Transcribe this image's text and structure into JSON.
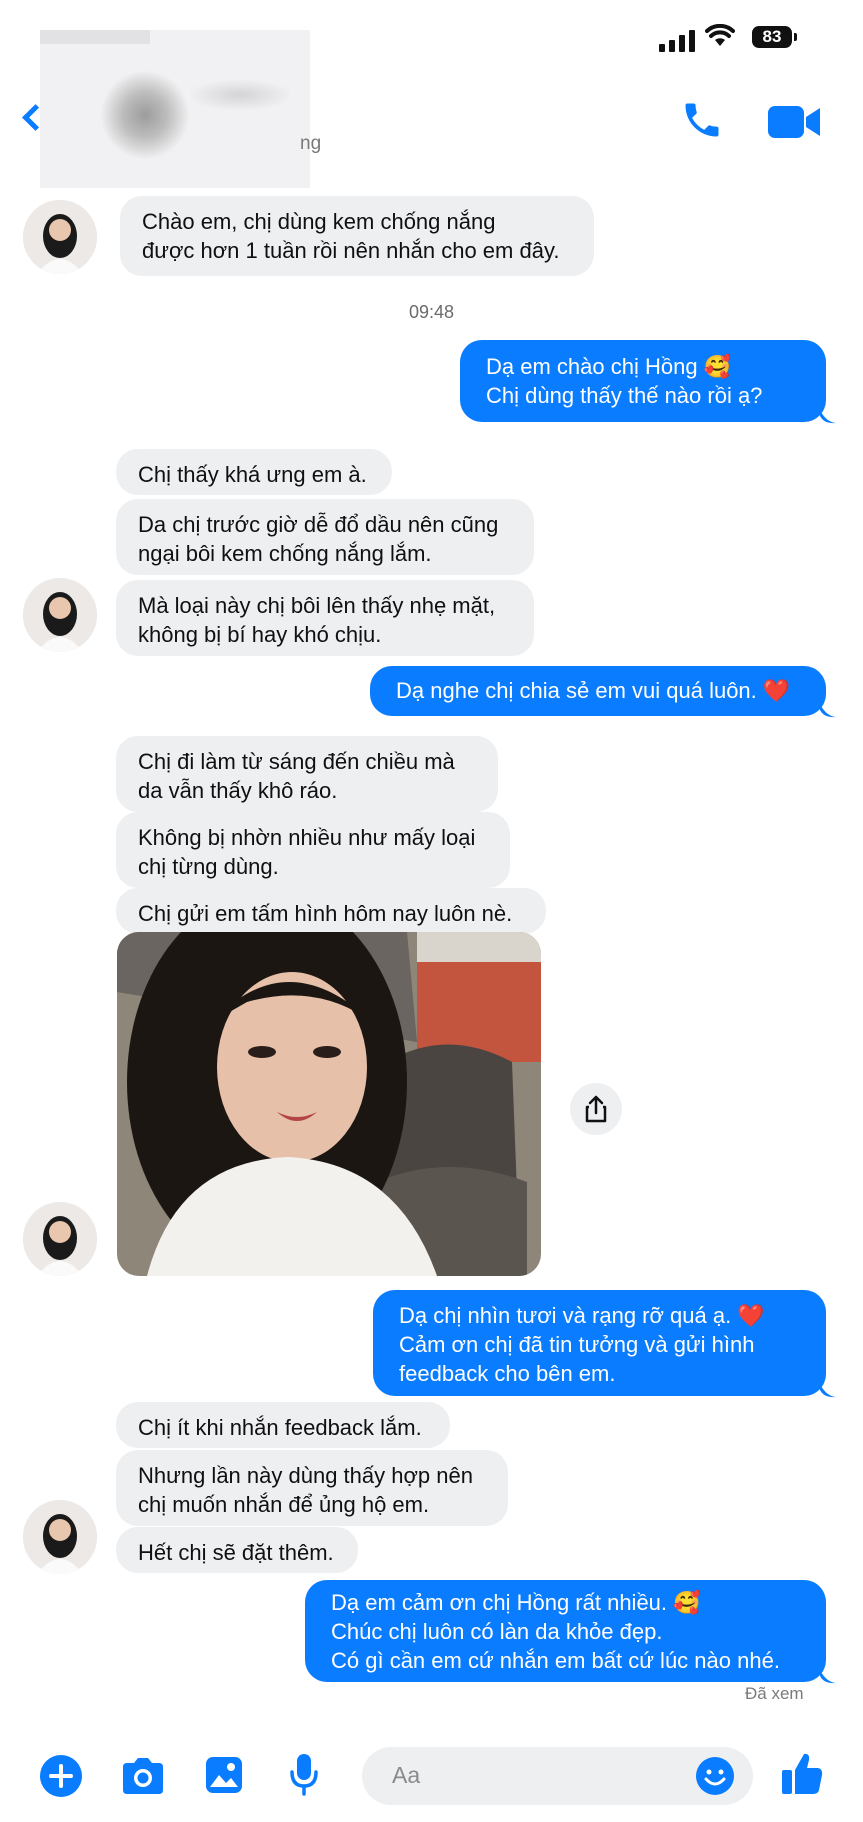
{
  "status_bar": {
    "battery": "83"
  },
  "header": {
    "contact_sub": "ng"
  },
  "messages": {
    "m1": "Chào em, chị dùng kem chống nắng\nđược hơn 1 tuần rồi nên nhắn cho em đây.",
    "time1": "09:48",
    "m2": "Dạ em chào chị Hồng 🥰\nChị dùng thấy thế nào rồi ạ?",
    "m3": "Chị thấy khá ưng em à.",
    "m4": "Da chị trước giờ dễ đổ dầu nên cũng\nngại bôi kem chống nắng lắm.",
    "m5": "Mà loại này chị bôi lên thấy nhẹ mặt,\nkhông bị bí hay khó chịu.",
    "m6": "Dạ nghe chị chia sẻ em vui quá luôn. ❤️",
    "m7": "Chị đi làm từ sáng đến chiều mà\nda vẫn thấy khô ráo.",
    "m8": "Không bị nhờn nhiều như mấy loại\nchị từng dùng.",
    "m9": "Chị gửi em tấm hình hôm nay luôn nè.",
    "m10": "Dạ chị nhìn tươi và rạng rỡ quá ạ. ❤️\nCảm ơn chị đã tin tưởng và gửi hình\nfeedback cho bên em.",
    "m11": "Chị ít khi nhắn feedback lắm.",
    "m12": "Nhưng lần này dùng thấy hợp nên\nchị muốn nhắn để ủng hộ em.",
    "m13": "Hết chị sẽ đặt thêm.",
    "m14": "Dạ em cảm ơn chị Hồng rất nhiều. 🥰\nChúc chị luôn có làn da khỏe đẹp.\nCó gì cần em cứ nhắn em bất cứ lúc nào nhé.",
    "seen": "Đã xem"
  },
  "composer": {
    "placeholder": "Aa"
  },
  "colors": {
    "accent": "#0a7cff",
    "incoming_bubble": "#eeeff1"
  },
  "icons": [
    "back-icon",
    "phone-icon",
    "video-icon",
    "share-icon",
    "plus-icon",
    "camera-icon",
    "gallery-icon",
    "microphone-icon",
    "emoji-icon",
    "like-icon"
  ]
}
